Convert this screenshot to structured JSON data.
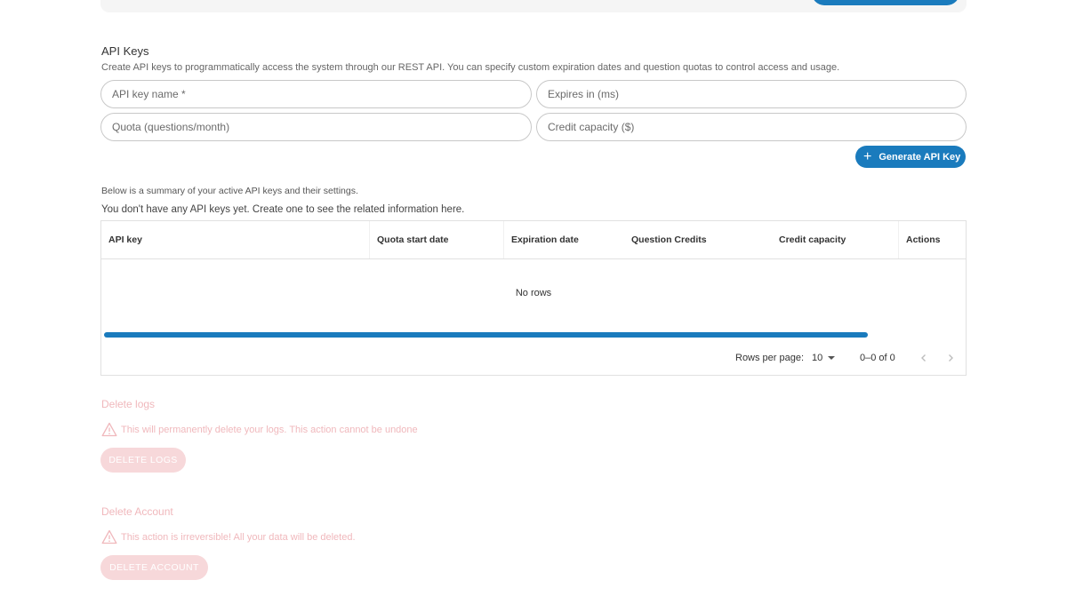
{
  "api_keys": {
    "title": "API Keys",
    "description": "Create API keys to programmatically access the system through our REST API. You can specify custom expiration dates and question quotas to control access and usage.",
    "fields": {
      "name_placeholder": "API key name *",
      "expires_placeholder": "Expires in (ms)",
      "quota_placeholder": "Quota (questions/month)",
      "credit_placeholder": "Credit capacity ($)"
    },
    "generate_label": "Generate API Key",
    "summary_text": "Below is a summary of your active API keys and their settings.",
    "empty_text": "You don't have any API keys yet. Create one to see the related information here.",
    "table": {
      "columns": [
        "API key",
        "Quota start date",
        "Expiration date",
        "Question Credits",
        "Credit capacity",
        "Actions"
      ],
      "no_rows": "No rows",
      "rows_per_page_label": "Rows per page:",
      "rows_per_page_value": "10",
      "range_text": "0–0 of 0"
    }
  },
  "delete_logs": {
    "title": "Delete logs",
    "warning": "This will permanently delete your logs. This action cannot be undone",
    "button": "DELETE LOGS"
  },
  "delete_account": {
    "title": "Delete Account",
    "warning": "This action is irreversible! All your data will be deleted.",
    "button": "DELETE ACCOUNT"
  },
  "colors": {
    "accent": "#1a7bbd",
    "danger_muted": "#f0b8bc",
    "danger_button": "#f7d8da"
  }
}
